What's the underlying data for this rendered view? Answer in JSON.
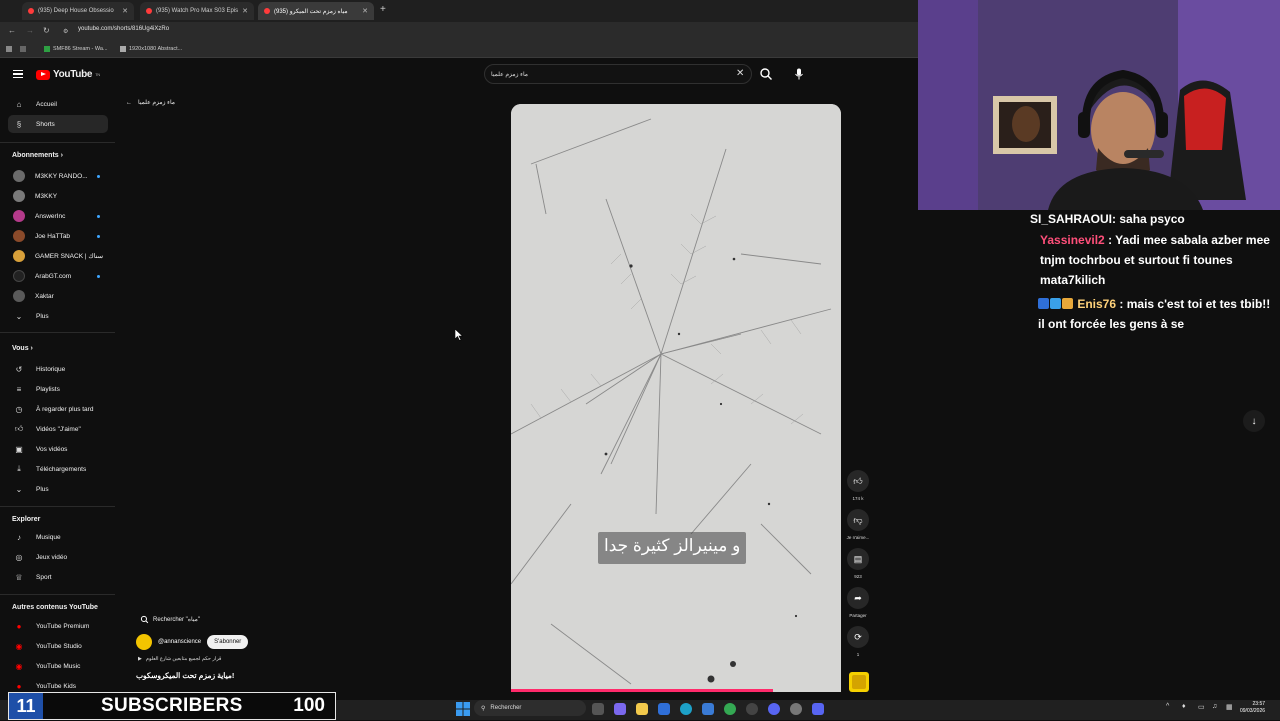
{
  "browser": {
    "tabs": [
      {
        "label": "(935) Deep House Obsessio",
        "active": false
      },
      {
        "label": "(935) Watch Pro Max S03 Epis",
        "active": false
      },
      {
        "label": "(935) مياه زمزم تحت الميكرو",
        "active": true
      }
    ],
    "url": "youtube.com/shorts/816Ug4iXzRo",
    "bookmarks": [
      "SMF86 Stream - Wa...",
      "1920x1080 Abstract..."
    ]
  },
  "youtube": {
    "logo_text": "YouTube",
    "logo_sup": "TN",
    "search_value": "ماء زمزم علميا",
    "back_label": "ماء زمزم علميا",
    "sidebar": {
      "main": [
        {
          "label": "Accueil",
          "icon": "home-icon"
        },
        {
          "label": "Shorts",
          "icon": "shorts-icon",
          "active": true
        }
      ],
      "subscriptions_title": "Abonnements",
      "subscriptions": [
        {
          "label": "M3KKY RANDO...",
          "live": true,
          "color": "#6b6b6b"
        },
        {
          "label": "M3KKY",
          "live": false,
          "color": "#7a7a7a"
        },
        {
          "label": "AnswerInc",
          "live": true,
          "color": "#b43a8a"
        },
        {
          "label": "Joe HaTTab",
          "live": true,
          "color": "#8a4a2a"
        },
        {
          "label": "GAMER SNACK | سناك",
          "live": false,
          "color": "#d8a03a"
        },
        {
          "label": "ArabGT.com",
          "live": true,
          "color": "#222222"
        },
        {
          "label": "Xaktar",
          "live": false,
          "color": "#5a5a5a"
        },
        {
          "label": "Plus",
          "live": false,
          "color": ""
        }
      ],
      "you_title": "Vous",
      "you": [
        {
          "label": "Historique",
          "icon": "history-icon"
        },
        {
          "label": "Playlists",
          "icon": "playlist-icon"
        },
        {
          "label": "À regarder plus tard",
          "icon": "clock-icon"
        },
        {
          "label": "Vidéos \"J'aime\"",
          "icon": "like-icon"
        },
        {
          "label": "Vos vidéos",
          "icon": "video-icon"
        },
        {
          "label": "Téléchargements",
          "icon": "download-icon"
        },
        {
          "label": "Plus",
          "icon": "chevron-down-icon"
        }
      ],
      "explore_title": "Explorer",
      "explore": [
        {
          "label": "Musique",
          "icon": "music-icon"
        },
        {
          "label": "Jeux vidéo",
          "icon": "gamepad-icon"
        },
        {
          "label": "Sport",
          "icon": "trophy-icon"
        }
      ],
      "more_title": "Autres contenus YouTube",
      "more": [
        {
          "label": "YouTube Premium"
        },
        {
          "label": "YouTube Studio"
        },
        {
          "label": "YouTube Music"
        },
        {
          "label": "YouTube Kids"
        }
      ]
    },
    "short": {
      "caption": "و مينيرالز كثيرة جدا",
      "likes": "174 k",
      "dislike_label": "Je n'aime...",
      "comments": "923",
      "share_label": "Partager",
      "remix_count": "1",
      "channel": "@annanscience",
      "subscribe": "S'abonner",
      "search_hint": "Rechercher \"مياه\"",
      "desc": "قرار حكم لجميع متابعين شارع العلوم",
      "title": "مياية زمزم تحت الميكروسكوب!"
    }
  },
  "chat": [
    {
      "user": "SI_SAHRAOUI",
      "text": ": saha psyco",
      "color": "#ff4f4f"
    },
    {
      "user": "Yassinevil2",
      "text": ": Yadi mee sabala azber mee tnjm tochrbou et surtout fi tounes mata7kilich",
      "color": "#ff4f7a"
    },
    {
      "user": "Enis76",
      "text": ": mais c'est toi et tes tbib!! il ont forcée les gens à se",
      "color": "#ffd27a"
    }
  ],
  "overlay": {
    "day": "11",
    "label": "SUBSCRIBERS",
    "count": "100"
  },
  "taskbar": {
    "search_label": "Rechercher",
    "time": "23:57",
    "date": "09/03/2026"
  }
}
